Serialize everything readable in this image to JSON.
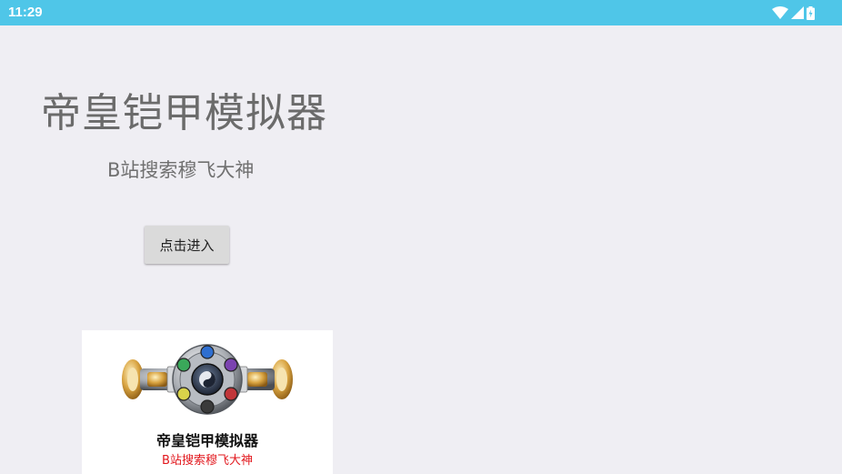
{
  "status_bar": {
    "time": "11:29",
    "icons": [
      "wifi-icon",
      "signal-icon",
      "battery-charging-icon"
    ]
  },
  "main": {
    "title": "帝皇铠甲模拟器",
    "subtitle": "B站搜索穆飞大神",
    "enter_button_label": "点击进入"
  },
  "card": {
    "title": "帝皇铠甲模拟器",
    "subtitle": "B站搜索穆飞大神",
    "image": "belt-illustration"
  },
  "colors": {
    "status_bar": "#4fc6e8",
    "background": "#efeef3",
    "button": "#dadada",
    "card_subtitle": "#e2181e"
  }
}
